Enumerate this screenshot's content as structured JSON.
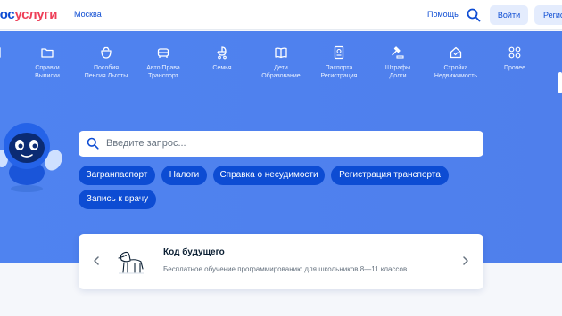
{
  "header": {
    "logo_part1": "гос",
    "logo_part2": "услуги",
    "city": "Москва",
    "help": "Помощь",
    "login": "Войти",
    "register": "Регистрация"
  },
  "nav": [
    {
      "icon": "partial-icon",
      "line1": "",
      "line2": ""
    },
    {
      "icon": "folder-icon",
      "line1": "Справки",
      "line2": "Выписки"
    },
    {
      "icon": "wallet-icon",
      "line1": "Пособия",
      "line2": "Пенсия Льготы"
    },
    {
      "icon": "car-icon",
      "line1": "Авто Права",
      "line2": "Транспорт"
    },
    {
      "icon": "stroller-icon",
      "line1": "Семья",
      "line2": ""
    },
    {
      "icon": "book-icon",
      "line1": "Дети",
      "line2": "Образование"
    },
    {
      "icon": "passport-icon",
      "line1": "Паспорта",
      "line2": "Регистрация"
    },
    {
      "icon": "gavel-icon",
      "line1": "Штрафы",
      "line2": "Долги"
    },
    {
      "icon": "house-icon",
      "line1": "Стройка",
      "line2": "Недвижимость"
    },
    {
      "icon": "grid-icon",
      "line1": "Прочее",
      "line2": ""
    }
  ],
  "search": {
    "placeholder": "Введите запрос..."
  },
  "chips": [
    "Загранпаспорт",
    "Налоги",
    "Справка о несудимости",
    "Регистрация транспорта",
    "Запись к врачу"
  ],
  "promo": {
    "title": "Код будущего",
    "subtitle": "Бесплатное обучение программированию для школьников 8—11 классов"
  },
  "colors": {
    "brand_blue": "#0d4cd3",
    "brand_red": "#ee3f58",
    "hero_bg": "#4f83f0"
  }
}
